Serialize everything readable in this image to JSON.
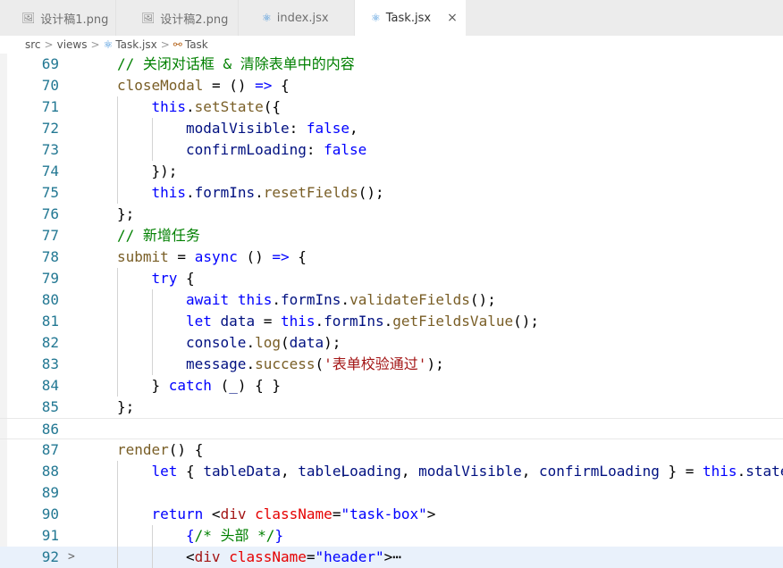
{
  "tabs": [
    {
      "label": "设计稿1.png",
      "icon": "image-icon"
    },
    {
      "label": "设计稿2.png",
      "icon": "image-icon"
    },
    {
      "label": "index.jsx",
      "icon": "react-icon"
    },
    {
      "label": "Task.jsx",
      "icon": "react-icon",
      "active": true,
      "close": "×"
    }
  ],
  "breadcrumb": {
    "items": [
      "src",
      "views",
      "Task.jsx",
      "Task"
    ],
    "separator": ">"
  },
  "editor": {
    "current_line": 86,
    "lines": [
      {
        "n": "69",
        "tokens": [
          [
            "cm",
            "// 关闭对话框 & 清除表单中的内容"
          ]
        ]
      },
      {
        "n": "70",
        "tokens": [
          [
            "fn",
            "closeModal"
          ],
          [
            "pun",
            " = () "
          ],
          [
            "kw",
            "=>"
          ],
          [
            "pun",
            " {"
          ]
        ]
      },
      {
        "n": "71",
        "tokens": [
          [
            "kw",
            "this"
          ],
          [
            "pun",
            "."
          ],
          [
            "fn",
            "setState"
          ],
          [
            "pun",
            "({"
          ]
        ]
      },
      {
        "n": "72",
        "tokens": [
          [
            "pr",
            "modalVisible"
          ],
          [
            "pun",
            ": "
          ],
          [
            "kw",
            "false"
          ],
          [
            "pun",
            ","
          ]
        ]
      },
      {
        "n": "73",
        "tokens": [
          [
            "pr",
            "confirmLoading"
          ],
          [
            "pun",
            ": "
          ],
          [
            "kw",
            "false"
          ]
        ]
      },
      {
        "n": "74",
        "tokens": [
          [
            "pun",
            "});"
          ]
        ]
      },
      {
        "n": "75",
        "tokens": [
          [
            "kw",
            "this"
          ],
          [
            "pun",
            "."
          ],
          [
            "pr",
            "formIns"
          ],
          [
            "pun",
            "."
          ],
          [
            "fn",
            "resetFields"
          ],
          [
            "pun",
            "();"
          ]
        ]
      },
      {
        "n": "76",
        "tokens": [
          [
            "pun",
            "};"
          ]
        ]
      },
      {
        "n": "77",
        "tokens": [
          [
            "cm",
            "// 新增任务"
          ]
        ]
      },
      {
        "n": "78",
        "tokens": [
          [
            "fn",
            "submit"
          ],
          [
            "pun",
            " = "
          ],
          [
            "kw",
            "async"
          ],
          [
            "pun",
            " () "
          ],
          [
            "kw",
            "=>"
          ],
          [
            "pun",
            " {"
          ]
        ]
      },
      {
        "n": "79",
        "tokens": [
          [
            "kw",
            "try"
          ],
          [
            "pun",
            " {"
          ]
        ]
      },
      {
        "n": "80",
        "tokens": [
          [
            "kw",
            "await"
          ],
          [
            "pun",
            " "
          ],
          [
            "kw",
            "this"
          ],
          [
            "pun",
            "."
          ],
          [
            "pr",
            "formIns"
          ],
          [
            "pun",
            "."
          ],
          [
            "fn",
            "validateFields"
          ],
          [
            "pun",
            "();"
          ]
        ]
      },
      {
        "n": "81",
        "tokens": [
          [
            "kw",
            "let"
          ],
          [
            "pun",
            " "
          ],
          [
            "pr",
            "data"
          ],
          [
            "pun",
            " = "
          ],
          [
            "kw",
            "this"
          ],
          [
            "pun",
            "."
          ],
          [
            "pr",
            "formIns"
          ],
          [
            "pun",
            "."
          ],
          [
            "fn",
            "getFieldsValue"
          ],
          [
            "pun",
            "();"
          ]
        ]
      },
      {
        "n": "82",
        "tokens": [
          [
            "pr",
            "console"
          ],
          [
            "pun",
            "."
          ],
          [
            "fn",
            "log"
          ],
          [
            "pun",
            "("
          ],
          [
            "pr",
            "data"
          ],
          [
            "pun",
            ");"
          ]
        ]
      },
      {
        "n": "83",
        "tokens": [
          [
            "pr",
            "message"
          ],
          [
            "pun",
            "."
          ],
          [
            "fn",
            "success"
          ],
          [
            "pun",
            "("
          ],
          [
            "str",
            "'表单校验通过'"
          ],
          [
            "pun",
            ");"
          ]
        ]
      },
      {
        "n": "84",
        "tokens": [
          [
            "pun",
            "} "
          ],
          [
            "kw",
            "catch"
          ],
          [
            "pun",
            " ("
          ],
          [
            "pr",
            "_"
          ],
          [
            "pun",
            ") { }"
          ]
        ]
      },
      {
        "n": "85",
        "tokens": [
          [
            "pun",
            "};"
          ]
        ]
      },
      {
        "n": "86",
        "tokens": []
      },
      {
        "n": "87",
        "tokens": [
          [
            "fn",
            "render"
          ],
          [
            "pun",
            "() {"
          ]
        ]
      },
      {
        "n": "88",
        "tokens": [
          [
            "kw",
            "let"
          ],
          [
            "pun",
            " { "
          ],
          [
            "pr",
            "tableData"
          ],
          [
            "pun",
            ", "
          ],
          [
            "pr",
            "tableLoading"
          ],
          [
            "pun",
            ", "
          ],
          [
            "pr",
            "modalVisible"
          ],
          [
            "pun",
            ", "
          ],
          [
            "pr",
            "confirmLoading"
          ],
          [
            "pun",
            " } = "
          ],
          [
            "kw",
            "this"
          ],
          [
            "pun",
            "."
          ],
          [
            "pr",
            "state"
          ]
        ]
      },
      {
        "n": "89",
        "tokens": []
      },
      {
        "n": "90",
        "tokens": [
          [
            "kw",
            "return"
          ],
          [
            "pun",
            " <"
          ],
          [
            "str",
            "div"
          ],
          [
            "pun",
            " "
          ],
          [
            "attr",
            "className"
          ],
          [
            "pun",
            "="
          ],
          [
            "kw",
            "\"task-box\""
          ],
          [
            "pun",
            ">"
          ]
        ]
      },
      {
        "n": "91",
        "tokens": [
          [
            "kw",
            "{"
          ],
          [
            "cm",
            "/* 头部 */"
          ],
          [
            "kw",
            "}"
          ]
        ]
      },
      {
        "n": "92",
        "fold": ">",
        "tokens": [
          [
            "pun",
            "<"
          ],
          [
            "str",
            "div"
          ],
          [
            "pun",
            " "
          ],
          [
            "attr",
            "className"
          ],
          [
            "pun",
            "="
          ],
          [
            "kw",
            "\"header\""
          ],
          [
            "pun",
            ">"
          ],
          [
            "pun",
            "⋯"
          ]
        ]
      }
    ]
  }
}
